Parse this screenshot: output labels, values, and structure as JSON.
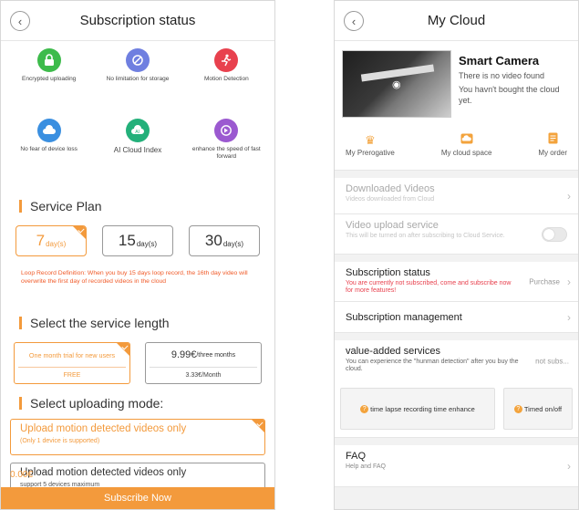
{
  "left": {
    "title": "Subscription status",
    "features": [
      {
        "label": "Encrypted uploading",
        "icon": "lock-icon",
        "color": "#3dbb4b"
      },
      {
        "label": "No limitation for storage",
        "icon": "unlimited-icon",
        "color": "#6f7fe0"
      },
      {
        "label": "Motion Detection",
        "icon": "motion-person-icon",
        "color": "#e8414e"
      },
      {
        "label": "No fear of device loss",
        "icon": "cloud-icon",
        "color": "#3a8fe0"
      },
      {
        "label": "AI Cloud Index",
        "icon": "ai-cloud-icon",
        "color": "#23b07a"
      },
      {
        "label": "enhance the speed of fast forward",
        "icon": "fast-forward-icon",
        "color": "#9b59d0"
      }
    ],
    "service_plan_heading": "Service Plan",
    "plans": [
      {
        "num": "7",
        "unit": "day(s)",
        "selected": true
      },
      {
        "num": "15",
        "unit": "day(s)",
        "selected": false
      },
      {
        "num": "30",
        "unit": "day(s)",
        "selected": false
      }
    ],
    "loop_note": "Loop Record Definition: When you buy 15 days loop record, the 16th day video will overwrite the first day of recorded videos in the cloud",
    "length_heading": "Select the service length",
    "trials": [
      {
        "top": "One month trial for new users",
        "bottom": "FREE",
        "selected": true
      },
      {
        "price": "9.99€",
        "per": "/three months",
        "bottom": "3.33€/Month",
        "selected": false
      }
    ],
    "mode_heading": "Select uploading mode:",
    "modes": [
      {
        "title": "Upload motion detected videos only",
        "sub": "(Only 1 device is supported)",
        "selected": true
      },
      {
        "title": "Upload motion detected videos only",
        "sub": "support 5 devices maximum",
        "selected": false
      }
    ],
    "total": "0.00€",
    "subscribe_label": "Subscribe Now",
    "accent": "#f39a3c"
  },
  "right": {
    "title": "My Cloud",
    "camera": {
      "name": "Smart Camera",
      "line1": "There is no video found",
      "line2": "You havn't bought the cloud yet."
    },
    "tabs": [
      {
        "label": "My Prerogative",
        "icon": "crown-icon"
      },
      {
        "label": "My cloud space",
        "icon": "cloud-space-icon"
      },
      {
        "label": "My order",
        "icon": "order-icon"
      }
    ],
    "downloaded": {
      "title": "Downloaded Videos",
      "sub": "Videos downloaded from Cloud"
    },
    "upload_service": {
      "title": "Video upload service",
      "sub": "This will be turned on after subscribing to Cloud Service."
    },
    "subscription_status": {
      "title": "Subscription status",
      "sub": "You are currently not subscribed, come and subscribe now for more features!",
      "action": "Purchase"
    },
    "subscription_management": {
      "title": "Subscription management"
    },
    "vas": {
      "title": "value-added services",
      "sub": "You can experience the \"hunman detection\" after you buy the cloud.",
      "status": "not subs..."
    },
    "vas_buttons": [
      {
        "label": "time lapse recording time enhance"
      },
      {
        "label": "Timed on/off"
      }
    ],
    "faq": {
      "title": "FAQ",
      "sub": "Help and FAQ"
    }
  }
}
